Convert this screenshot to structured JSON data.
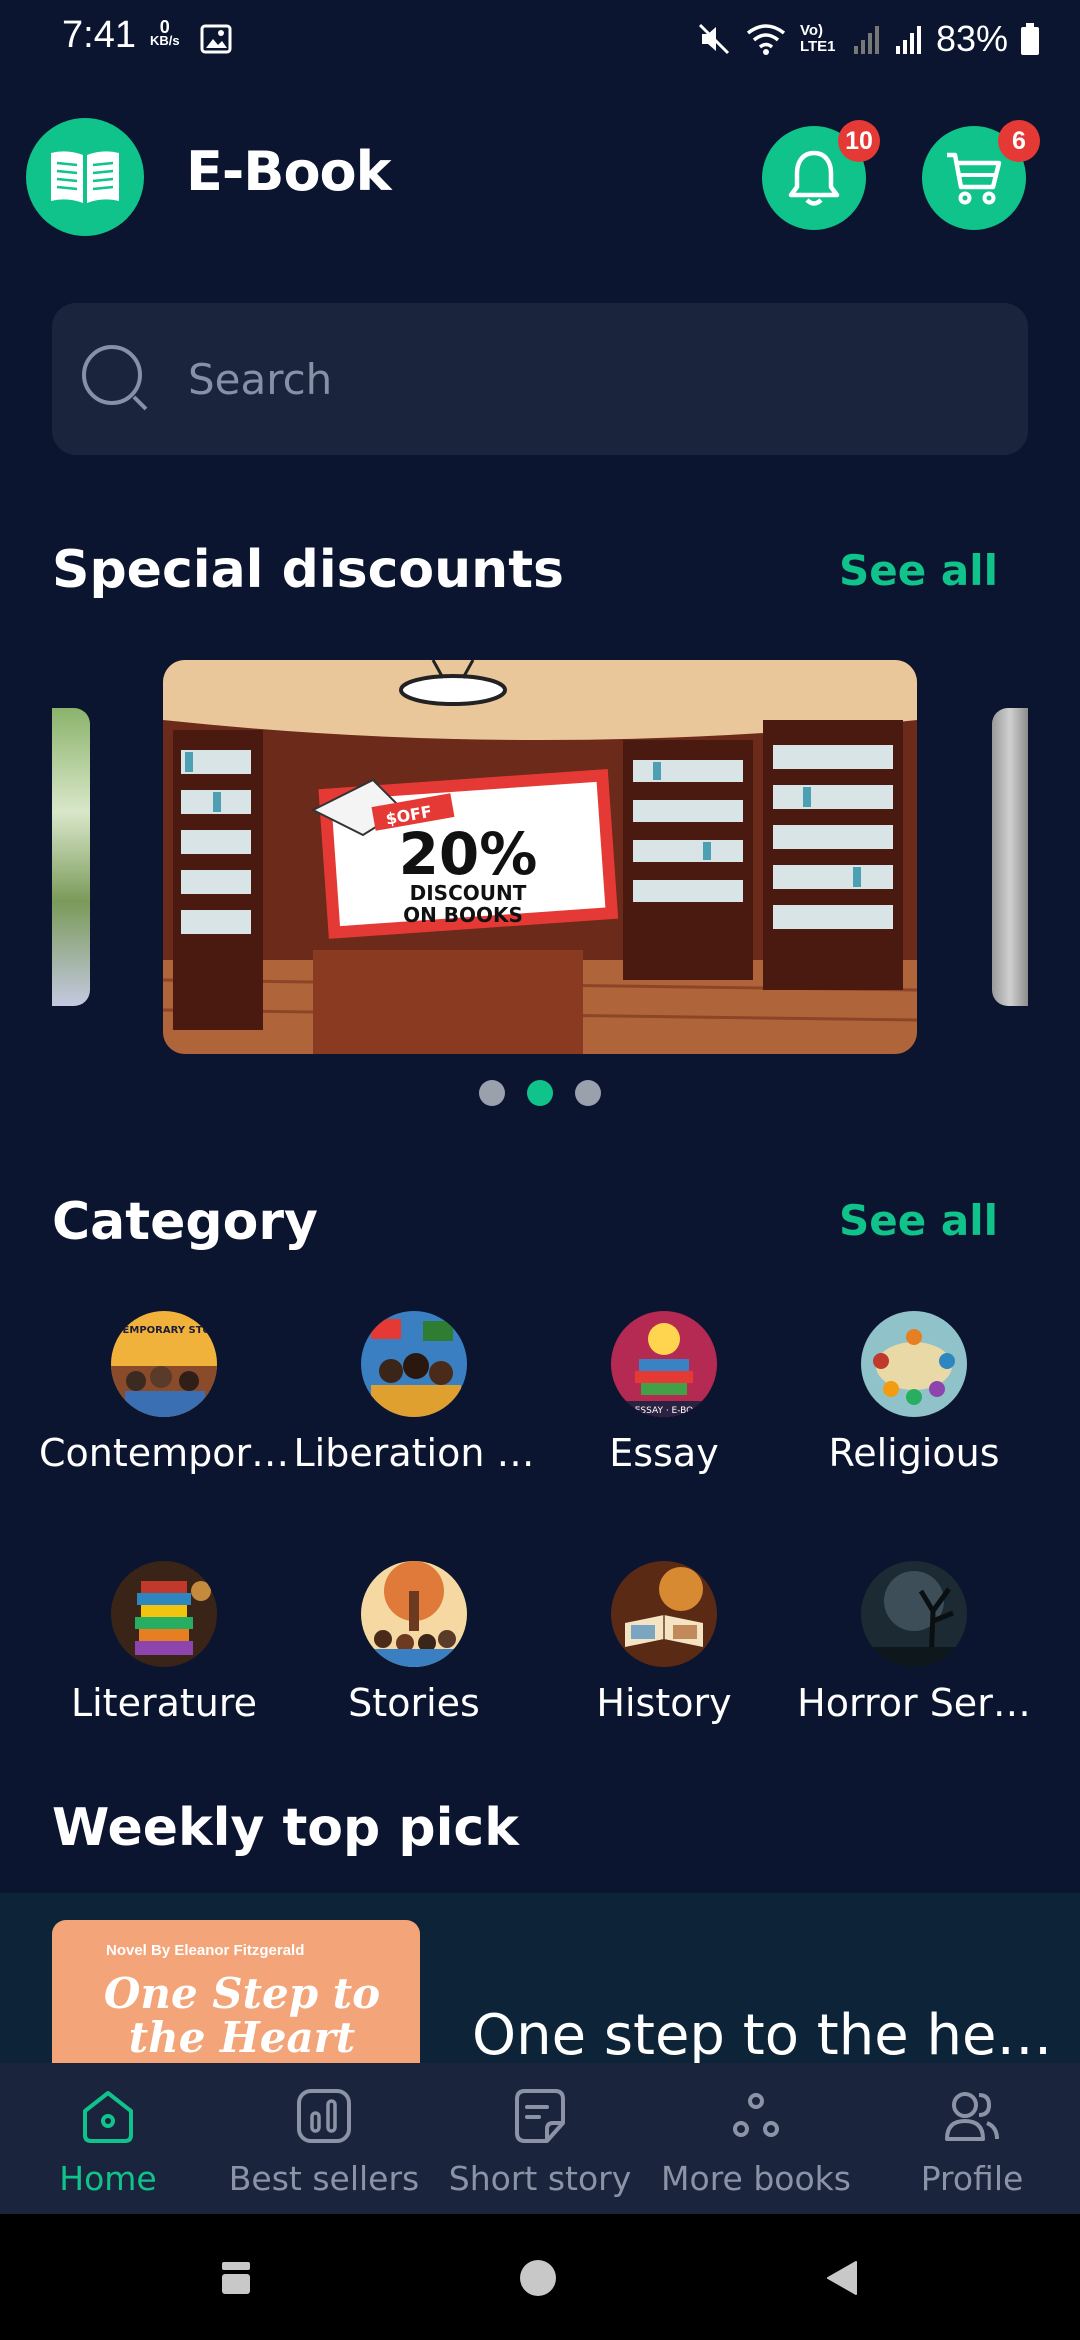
{
  "status_bar": {
    "time": "7:41",
    "kbs_value": "0",
    "kbs_unit": "KB/s",
    "network_label": "Vo) LTE1",
    "battery": "83%"
  },
  "header": {
    "title": "E-Book",
    "notifications_count": "10",
    "cart_count": "6"
  },
  "search": {
    "placeholder": "Search"
  },
  "special_discounts": {
    "title": "Special discounts",
    "see_all": "See all",
    "banner": {
      "ribbon": "$OFF",
      "headline": "20%",
      "line1": "DISCOUNT",
      "line2": "ON BOOKS"
    },
    "active_slide": 2,
    "total_slides": 3
  },
  "category": {
    "title": "Category",
    "see_all": "See all",
    "items": [
      {
        "label": "Contempor…",
        "cover_text": "CONTEMPORARY STORIES"
      },
      {
        "label": "Liberation …"
      },
      {
        "label": "Essay",
        "cover_text": "ESSAY · E-BO"
      },
      {
        "label": "Religious"
      },
      {
        "label": "Literature"
      },
      {
        "label": "Stories"
      },
      {
        "label": "History"
      },
      {
        "label": "Horror Ser…"
      }
    ]
  },
  "weekly": {
    "title": "Weekly top pick",
    "book": {
      "by": "Novel By  Eleanor Fitzgerald",
      "cover_title": "One Step to the Heart",
      "title": "One step to the he…"
    }
  },
  "bottom_nav": {
    "items": [
      {
        "label": "Home",
        "icon": "home-icon",
        "active": true
      },
      {
        "label": "Best sellers",
        "icon": "chart-icon",
        "active": false
      },
      {
        "label": "Short story",
        "icon": "document-icon",
        "active": false
      },
      {
        "label": "More books",
        "icon": "dots-icon",
        "active": false
      },
      {
        "label": "Profile",
        "icon": "users-icon",
        "active": false
      }
    ]
  },
  "colors": {
    "background": "#0b1530",
    "accent": "#10c38a",
    "surface": "#1a243d",
    "badge": "#e53935"
  }
}
